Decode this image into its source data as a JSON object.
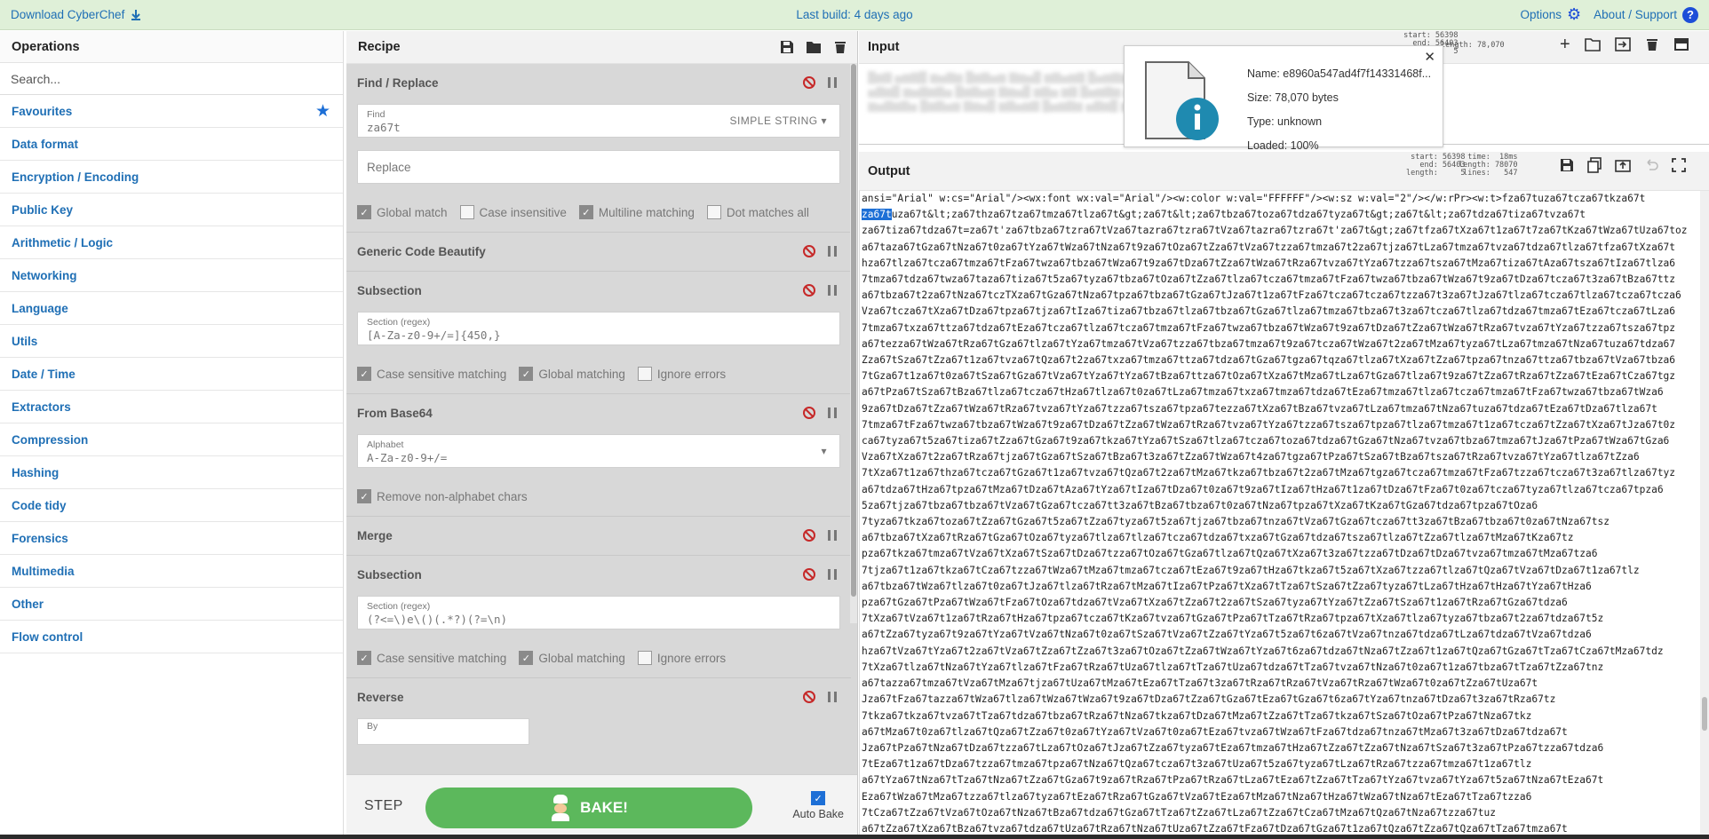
{
  "banner": {
    "download": "Download CyberChef",
    "last_build": "Last build: 4 days ago",
    "options": "Options",
    "about": "About / Support"
  },
  "operations": {
    "title": "Operations",
    "search_placeholder": "Search...",
    "categories": [
      "Favourites",
      "Data format",
      "Encryption / Encoding",
      "Public Key",
      "Arithmetic / Logic",
      "Networking",
      "Language",
      "Utils",
      "Date / Time",
      "Extractors",
      "Compression",
      "Hashing",
      "Code tidy",
      "Forensics",
      "Multimedia",
      "Other",
      "Flow control"
    ]
  },
  "recipe": {
    "title": "Recipe",
    "ops": {
      "find_replace": {
        "title": "Find / Replace",
        "find_label": "Find",
        "find_value": "za67t",
        "find_mode": "SIMPLE STRING",
        "replace_placeholder": "Replace",
        "checks": [
          "Global match",
          "Case insensitive",
          "Multiline matching",
          "Dot matches all"
        ]
      },
      "beautify": {
        "title": "Generic Code Beautify"
      },
      "subsection1": {
        "title": "Subsection",
        "section_label": "Section (regex)",
        "section_value": "[A-Za-z0-9+/=]{450,}",
        "checks": [
          "Case sensitive matching",
          "Global matching",
          "Ignore errors"
        ]
      },
      "from_base64": {
        "title": "From Base64",
        "alphabet_label": "Alphabet",
        "alphabet_value": "A-Za-z0-9+/=",
        "checks": [
          "Remove non-alphabet chars"
        ]
      },
      "merge": {
        "title": "Merge"
      },
      "subsection2": {
        "title": "Subsection",
        "section_label": "Section (regex)",
        "section_value": "(?<=\\)e\\()(.*?)(?=\\n)",
        "checks": [
          "Case sensitive matching",
          "Global matching",
          "Ignore errors"
        ]
      },
      "reverse": {
        "title": "Reverse",
        "by_label": "By"
      }
    },
    "step": "STEP",
    "bake": "BAKE!",
    "auto_bake": "Auto Bake"
  },
  "input": {
    "title": "Input",
    "stats": "start: 56398\n  end: 56403\nlength:     5",
    "length": "length: 78,070",
    "file": {
      "name": "Name: e8960a547ad4f7f14331468f...",
      "size": "Size: 78,070 bytes",
      "type": "Type: unknown",
      "loaded": "Loaded: 100%"
    }
  },
  "output": {
    "title": "Output",
    "stats_left": "start: 56398\n  end: 56403\nlength:     5",
    "stats_right": " time:  18ms\nlength: 78070\n lines:   547",
    "first_line": "ansi=\"Arial\" w:cs=\"Arial\"/><wx:font wx:val=\"Arial\"/><w:color w:val=\"FFFFFF\"/><w:sz w:val=\"2\"/></w:rPr><w:t>fza67tuza67tcza67tkza67t",
    "selected": "za67t",
    "second_line_rest": "uza67t&lt;za67thza67tza67tmza67tlza67t&gt;za67t&lt;za67tbza67toza67tdza67tyza67t&gt;za67t&lt;za67tdza67tiza67tvza67t",
    "body_lines": [
      "za67tiza67tdza67t=za67t'za67tbza67tzra67tVza67tazra67tzra67tVza67tazra67tzra67t'za67t&gt;za67tfza67tXza67t1za67t7za67tKza67tWza67tUza67toz",
      "a67taza67tGza67tNza67t0za67tYza67tWza67tNza67t9za67tOza67tZza67tVza67tzza67tmza67t2za67tjza67tLza67tmza67tvza67tdza67tlza67tfza67tXza67t",
      "hza67tlza67tcza67tmza67tFza67twza67tbza67tWza67t9za67tDza67tZza67tWza67tRza67tvza67tYza67tzza67tsza67tMza67tiza67tAza67tsza67tIza67tlza6",
      "7tmza67tdza67twza67taza67tiza67t5za67tyza67tbza67tOza67tZza67tlza67tcza67tmza67tFza67twza67tbza67tWza67t9za67tDza67tcza67t3za67tBza67ttz",
      "a67tbza67t2za67tNza67tczTXza67tGza67tNza67tpza67tbza67tGza67tJza67t1za67tFza67tcza67tcza67tzza67t3za67tJza67tlza67tcza67tlza67tcza67tcza6",
      "Vza67tcza67tXza67tDza67tpza67tjza67tIza67tiza67tbza67tlza67tbza67tGza67tlza67tmza67tbza67t3za67tcza67tlza67tdza67tmza67tEza67tcza67tLza6",
      "7tmza67txza67ttza67tdza67tEza67tcza67tlza67tcza67tmza67tFza67twza67tbza67tWza67t9za67tDza67tZza67tWza67tRza67tvza67tYza67tzza67tsza67tpz",
      "a67tezza67tWza67tRza67tGza67tlza67tYza67tmza67tVza67tzza67tbza67tmza67t9za67tcza67tWza67t2za67tMza67tyza67tLza67tmza67tNza67tuza67tdza67",
      "Zza67tSza67tZza67t1za67tvza67tQza67t2za67txza67tmza67ttza67tdza67tGza67tgza67tqza67tlza67tXza67tZza67tpza67tnza67ttza67tbza67tVza67tbza6",
      "7tGza67t1za67t0za67tSza67tGza67tVza67tYza67tYza67tBza67ttza67tOza67tXza67tMza67tLza67tGza67tlza67t9za67tZza67tRza67tZza67tEza67tCza67tgz",
      "a67tPza67tSza67tBza67tlza67tcza67tHza67tlza67t0za67tLza67tmza67txza67tmza67tdza67tEza67tmza67tlza67tcza67tmza67tFza67twza67tbza67tWza6",
      "9za67tDza67tZza67tWza67tRza67tvza67tYza67tzza67tsza67tpza67tezza67tXza67tBza67tvza67tLza67tmza67tNza67tuza67tdza67tEza67tDza67tlza67t",
      "7tmza67tFza67twza67tbza67tWza67t9za67tDza67tZza67tWza67tRza67tvza67tYza67tzza67tsza67tpza67tlza67tmza67t1za67tcza67tZza67tXza67tJza67t0z",
      "ca67tyza67t5za67tiza67tZza67tGza67t9za67tkza67tYza67tSza67tlza67tcza67toza67tdza67tGza67tNza67tvza67tbza67tmza67tJza67tPza67tWza67tGza6",
      "Vza67tXza67t2za67tRza67tjza67tGza67tSza67tBza67t3za67tZza67tWza67t4za67tgza67tPza67tSza67tBza67tsza67tRza67tvza67tYza67tlza67tZza6",
      "7tXza67t1za67thza67tcza67tGza67t1za67tvza67tQza67t2za67tMza67tkza67tbza67t2za67tMza67tgza67tcza67tmza67tFza67tzza67tcza67t3za67tlza67tyz",
      "a67tdza67tHza67tpza67tMza67tDza67tAza67tYza67tIza67tDza67t0za67t9za67tIza67tHza67t1za67tDza67tFza67t0za67tcza67tyza67tlza67tcza67tpza6",
      "5za67tjza67tbza67tbza67tVza67tGza67tcza67tt3za67tBza67tbza67t0za67tNza67tpza67tXza67tKza67tGza67tdza67tpza67tOza6",
      "7tyza67tkza67toza67tZza67tGza67t5za67tZza67tyza67t5za67tjza67tbza67tnza67tVza67tGza67tcza67tt3za67tBza67tbza67t0za67tNza67tsz",
      "a67tbza67tXza67tRza67tGza67tOza67tyza67tlza67tlza67tcza67tdza67txza67tGza67tdza67tsza67tlza67tZza67tlza67tMza67tKza67tz",
      "pza67tkza67tmza67tVza67tXza67tSza67tDza67tzza67tOza67tGza67tlza67tQza67tXza67t3za67tzza67tDza67tDza67tvza67tmza67tMza67tza6",
      "7tjza67t1za67tkza67tCza67tzza67tWza67tMza67tmza67tcza67tEza67t9za67tHza67tkza67t5za67tXza67tzza67tlza67tQza67tVza67tDza67t1za67tlz",
      "a67tbza67tWza67tlza67t0za67tJza67tlza67tRza67tMza67tIza67tPza67tXza67tTza67tSza67tZza67tyza67tLza67tHza67tHza67tYza67tHza6",
      "pza67tGza67tPza67tWza67tFza67tOza67tdza67tVza67tXza67tZza67t2za67tSza67tyza67tYza67tZza67tSza67t1za67tRza67tGza67tdza6",
      "7tXza67tVza67t1za67tRza67tHza67tpza67tcza67tKza67tvza67tGza67tPza67tTza67tRza67tpza67tXza67tlza67tyza67tbza67t2za67tdza67t5z",
      "a67tZza67tyza67t9za67tYza67tVza67tNza67t0za67tSza67tVza67tZza67tYza67t5za67t6za67tVza67tnza67tdza67tLza67tdza67tVza67tdza6",
      "hza67tVza67tYza67t2za67tVza67tZza67tZza67t3za67tOza67tZza67tWza67tYza67t6za67tdza67tNza67tZza67t1za67tQza67tGza67tTza67tCza67tMza67tdz",
      "7tXza67tlza67tNza67tYza67tlza67tFza67tRza67tUza67tlza67tTza67tUza67tdza67tTza67tvza67tNza67t0za67t1za67tbza67tTza67tZza67tnz",
      "a67tazza67tmza67tVza67tMza67tjza67tUza67tMza67tEza67tTza67t3za67tRza67tRza67tVza67tRza67tWza67t0za67tZza67tUza67t",
      "Jza67tFza67tazza67tWza67tlza67tWza67tWza67t9za67tDza67tZza67tGza67tEza67tGza67t6za67tYza67tnza67tDza67t3za67tRza67tz",
      "7tkza67tkza67tvza67tTza67tdza67tbza67tRza67tNza67tkza67tDza67tMza67tZza67tTza67tkza67tSza67tOza67tPza67tNza67tkz",
      "a67tMza67t0za67tlza67tQza67tZza67t0za67tYza67tVza67t0za67tEza67tvza67tWza67tFza67tdza67tnza67tMza67t3za67tDza67tdza67t",
      "Jza67tPza67tNza67tDza67tzza67tLza67tOza67tJza67tZza67tyza67tEza67tmza67tHza67tZza67tZza67tNza67tSza67t3za67tPza67tzza67tdza6",
      "7tEza67t1za67tDza67tzza67tmza67tpza67tNza67tQza67tcza67t3za67tUza67t5za67tyza67tLza67tRza67tzza67tmza67t1za67tlz",
      "a67tYza67tNza67tTza67tNza67tZza67tGza67t9za67tRza67tPza67tRza67tLza67tEza67tZza67tTza67tYza67tvza67tYza67t5za67tNza67tEza67t",
      "Eza67tWza67tMza67tzza67tlza67tyza67tEza67tRza67tGza67tVza67tEza67tMza67tNza67tHza67tWza67tNza67tEza67tTza67tzza6",
      "7tCza67tZza67tVza67tOza67tNza67tBza67tdza67tGza67tTza67tZza67tLza67tZza67tCza67tMza67tQza67tNza67tzza67tuz",
      "a67tZza67tXza67tBza67tvza67tdza67tUza67tRza67tNza67tUza67tZza67tFza67tDza67tGza67t1za67tQza67tZza67tQza67tTza67tmza67t"
    ]
  }
}
